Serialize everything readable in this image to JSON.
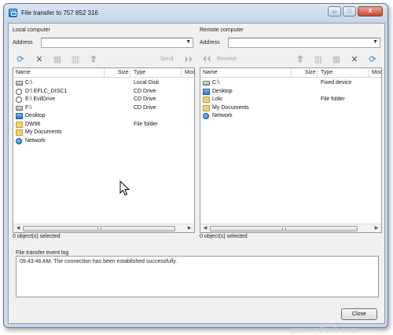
{
  "window": {
    "title": "File transfer to 757 852 316",
    "minimize_glyph": "▭",
    "maximize_glyph": "□",
    "close_glyph": "X"
  },
  "local": {
    "pane_title": "Local computer",
    "address_label": "Address",
    "address_value": "",
    "send_label": "Send",
    "columns": [
      "Name",
      "Size",
      "Type",
      "Moc"
    ],
    "rows": [
      {
        "icon": "drive-icon",
        "name": "C:\\",
        "size": "",
        "type": "Local Disk"
      },
      {
        "icon": "cd-drive-icon",
        "name": "D:\\  EFLC_DISC1",
        "size": "",
        "type": "CD Drive"
      },
      {
        "icon": "cd-drive-icon",
        "name": "E:\\  EvilDrive",
        "size": "",
        "type": "CD Drive"
      },
      {
        "icon": "drive-icon",
        "name": "F:\\",
        "size": "",
        "type": "CD Drive"
      },
      {
        "icon": "desktop-icon",
        "name": "Desktop",
        "size": "",
        "type": ""
      },
      {
        "icon": "folder-icon",
        "name": "DW96",
        "size": "",
        "type": "File folder"
      },
      {
        "icon": "documents-icon",
        "name": "My Documents",
        "size": "",
        "type": ""
      },
      {
        "icon": "network-icon",
        "name": "Network",
        "size": "",
        "type": ""
      }
    ],
    "status": "0 object(s) selected"
  },
  "remote": {
    "pane_title": "Remote computer",
    "address_label": "Address",
    "address_value": "",
    "receive_label": "Receive",
    "columns": [
      "Name",
      "Size",
      "Type",
      "Moc"
    ],
    "rows": [
      {
        "icon": "drive-icon",
        "name": "C:\\",
        "size": "",
        "type": "Fixed device"
      },
      {
        "icon": "desktop-icon",
        "name": "Desktop",
        "size": "",
        "type": ""
      },
      {
        "icon": "folder-icon",
        "name": "Loki",
        "size": "",
        "type": "File folder"
      },
      {
        "icon": "documents-icon",
        "name": "My Documents",
        "size": "",
        "type": ""
      },
      {
        "icon": "network-icon",
        "name": "Network",
        "size": "",
        "type": ""
      }
    ],
    "status": "0 object(s) selected"
  },
  "log": {
    "title": "File transfer event log",
    "lines": [
      "09:43:48 AM: The connection has been established successfully."
    ]
  },
  "footer": {
    "close_label": "Close",
    "watermark": "groovyPost.com"
  },
  "colors": {
    "frame": "#c9d7e8",
    "refresh_icon": "#2a7fd4",
    "delete_icon": "#555555",
    "disabled": "#b9b9b9"
  }
}
